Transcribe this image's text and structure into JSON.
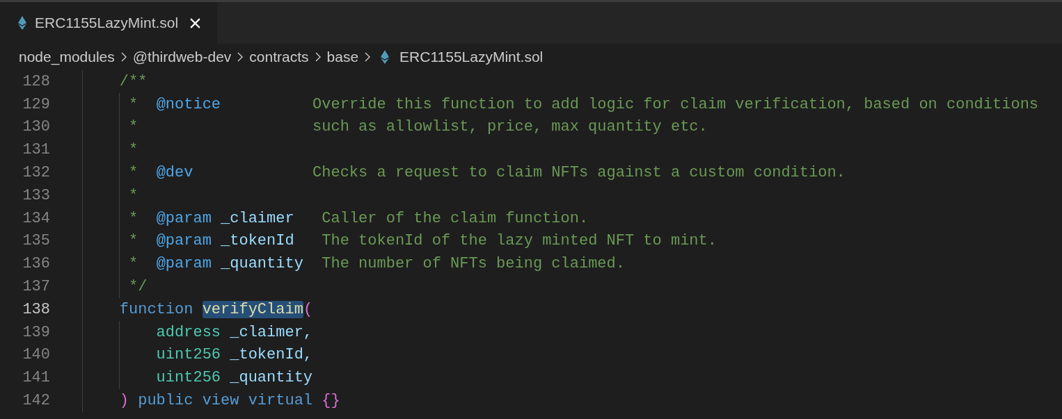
{
  "tabs": [
    {
      "label": "ERC1155LazyMint.sol",
      "selected": true
    }
  ],
  "breadcrumbs": [
    {
      "kind": "folder",
      "label": "node_modules"
    },
    {
      "kind": "folder",
      "label": "@thirdweb-dev"
    },
    {
      "kind": "folder",
      "label": "contracts"
    },
    {
      "kind": "folder",
      "label": "base"
    },
    {
      "kind": "file",
      "label": "ERC1155LazyMint.sol"
    }
  ],
  "lines": [
    {
      "number": "128",
      "current": false,
      "tokens": [
        {
          "kind": "comment",
          "text": "    /**",
          "selected": false
        }
      ]
    },
    {
      "number": "129",
      "current": false,
      "tokens": [
        {
          "kind": "comment",
          "text": "     *  ",
          "selected": false
        },
        {
          "kind": "tag",
          "text": "@notice",
          "selected": false
        },
        {
          "kind": "comment",
          "text": "          Override this function to add logic for claim verification, based on conditions",
          "selected": false
        }
      ]
    },
    {
      "number": "130",
      "current": false,
      "tokens": [
        {
          "kind": "comment",
          "text": "     *                   such as allowlist, price, max quantity etc.",
          "selected": false
        }
      ]
    },
    {
      "number": "131",
      "current": false,
      "tokens": [
        {
          "kind": "comment",
          "text": "     *",
          "selected": false
        }
      ]
    },
    {
      "number": "132",
      "current": false,
      "tokens": [
        {
          "kind": "comment",
          "text": "     *  ",
          "selected": false
        },
        {
          "kind": "tag",
          "text": "@dev",
          "selected": false
        },
        {
          "kind": "comment",
          "text": "             Checks a request to claim NFTs against a custom condition.",
          "selected": false
        }
      ]
    },
    {
      "number": "133",
      "current": false,
      "tokens": [
        {
          "kind": "comment",
          "text": "     *",
          "selected": false
        }
      ]
    },
    {
      "number": "134",
      "current": false,
      "tokens": [
        {
          "kind": "comment",
          "text": "     *  ",
          "selected": false
        },
        {
          "kind": "tag",
          "text": "@param",
          "selected": false
        },
        {
          "kind": "param",
          "text": " _claimer",
          "selected": false
        },
        {
          "kind": "comment",
          "text": "   Caller of the claim function.",
          "selected": false
        }
      ]
    },
    {
      "number": "135",
      "current": false,
      "tokens": [
        {
          "kind": "comment",
          "text": "     *  ",
          "selected": false
        },
        {
          "kind": "tag",
          "text": "@param",
          "selected": false
        },
        {
          "kind": "param",
          "text": " _tokenId",
          "selected": false
        },
        {
          "kind": "comment",
          "text": "   The tokenId of the lazy minted NFT to mint.",
          "selected": false
        }
      ]
    },
    {
      "number": "136",
      "current": false,
      "tokens": [
        {
          "kind": "comment",
          "text": "     *  ",
          "selected": false
        },
        {
          "kind": "tag",
          "text": "@param",
          "selected": false
        },
        {
          "kind": "param",
          "text": " _quantity",
          "selected": false
        },
        {
          "kind": "comment",
          "text": "  The number of NFTs being claimed.",
          "selected": false
        }
      ]
    },
    {
      "number": "137",
      "current": false,
      "tokens": [
        {
          "kind": "comment",
          "text": "     */",
          "selected": false
        }
      ]
    },
    {
      "number": "138",
      "current": true,
      "tokens": [
        {
          "kind": "keyword",
          "text": "    function ",
          "selected": false
        },
        {
          "kind": "function",
          "text": "verifyClaim",
          "selected": true
        },
        {
          "kind": "bracket",
          "text": "(",
          "selected": false
        }
      ]
    },
    {
      "number": "139",
      "current": false,
      "tokens": [
        {
          "kind": "type",
          "text": "        address",
          "selected": false
        },
        {
          "kind": "param",
          "text": " _claimer,",
          "selected": false
        }
      ]
    },
    {
      "number": "140",
      "current": false,
      "tokens": [
        {
          "kind": "type",
          "text": "        uint256",
          "selected": false
        },
        {
          "kind": "param",
          "text": " _tokenId,",
          "selected": false
        }
      ]
    },
    {
      "number": "141",
      "current": false,
      "tokens": [
        {
          "kind": "type",
          "text": "        uint256",
          "selected": false
        },
        {
          "kind": "param",
          "text": " _quantity",
          "selected": false
        }
      ]
    },
    {
      "number": "142",
      "current": false,
      "tokens": [
        {
          "kind": "bracket",
          "text": "    )",
          "selected": false
        },
        {
          "kind": "keyword",
          "text": " public view virtual ",
          "selected": false
        },
        {
          "kind": "bracket",
          "text": "{}",
          "selected": false
        }
      ]
    }
  ]
}
